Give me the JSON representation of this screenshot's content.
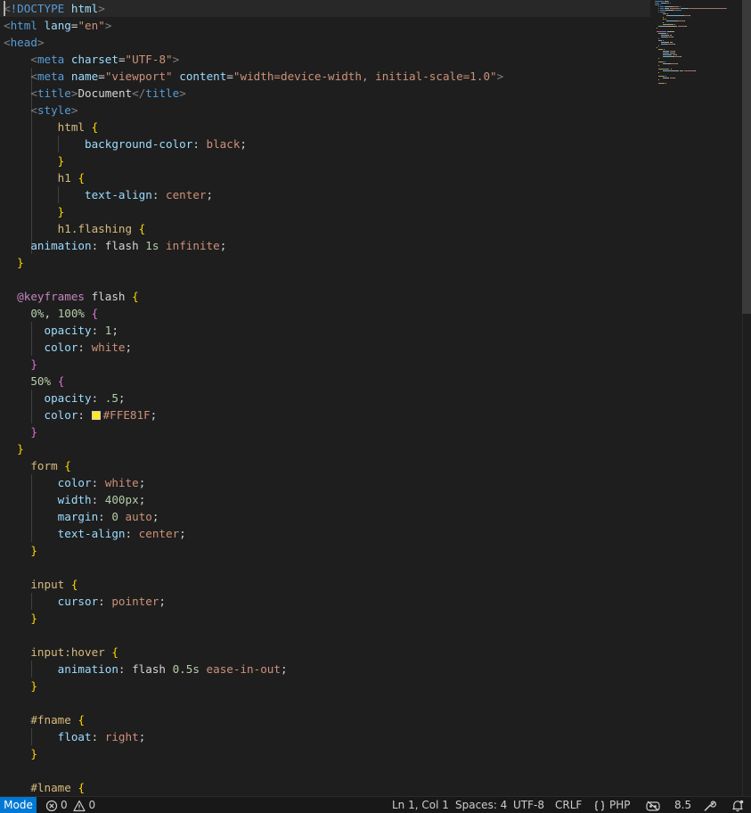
{
  "editor": {
    "lines": [
      [
        [
          "t-punc",
          "<"
        ],
        [
          "t-doctype",
          "!DOCTYPE"
        ],
        [
          "t-text",
          " "
        ],
        [
          "t-attr",
          "html"
        ],
        [
          "t-punc",
          ">"
        ]
      ],
      [
        [
          "t-punc",
          "<"
        ],
        [
          "t-tag",
          "html"
        ],
        [
          "t-text",
          " "
        ],
        [
          "t-attr",
          "lang"
        ],
        [
          "t-text",
          "="
        ],
        [
          "t-str",
          "\"en\""
        ],
        [
          "t-punc",
          ">"
        ]
      ],
      [
        [
          "t-punc",
          "<"
        ],
        [
          "t-tag",
          "head"
        ],
        [
          "t-punc",
          ">"
        ]
      ],
      [
        [
          "t-text",
          "    "
        ],
        [
          "t-punc",
          "<"
        ],
        [
          "t-tag",
          "meta"
        ],
        [
          "t-text",
          " "
        ],
        [
          "t-attr",
          "charset"
        ],
        [
          "t-text",
          "="
        ],
        [
          "t-str",
          "\"UTF-8\""
        ],
        [
          "t-punc",
          ">"
        ]
      ],
      [
        [
          "t-text",
          "    "
        ],
        [
          "t-punc",
          "<"
        ],
        [
          "t-tag",
          "meta"
        ],
        [
          "t-text",
          " "
        ],
        [
          "t-attr",
          "name"
        ],
        [
          "t-text",
          "="
        ],
        [
          "t-str",
          "\"viewport\""
        ],
        [
          "t-text",
          " "
        ],
        [
          "t-attr",
          "content"
        ],
        [
          "t-text",
          "="
        ],
        [
          "t-str",
          "\"width=device-width, initial-scale=1.0\""
        ],
        [
          "t-punc",
          ">"
        ]
      ],
      [
        [
          "t-text",
          "    "
        ],
        [
          "t-punc",
          "<"
        ],
        [
          "t-tag",
          "title"
        ],
        [
          "t-punc",
          ">"
        ],
        [
          "t-text",
          "Document"
        ],
        [
          "t-punc",
          "</"
        ],
        [
          "t-tag",
          "title"
        ],
        [
          "t-punc",
          ">"
        ]
      ],
      [
        [
          "t-text",
          "    "
        ],
        [
          "t-punc",
          "<"
        ],
        [
          "t-tag",
          "style"
        ],
        [
          "t-punc",
          ">"
        ]
      ],
      [
        [
          "t-text",
          "        "
        ],
        [
          "t-sel",
          "html"
        ],
        [
          "t-text",
          " "
        ],
        [
          "t-b1",
          "{"
        ]
      ],
      [
        [
          "t-text",
          "            "
        ],
        [
          "t-prop",
          "background-color"
        ],
        [
          "t-text",
          ": "
        ],
        [
          "t-val",
          "black"
        ],
        [
          "t-text",
          ";"
        ]
      ],
      [
        [
          "t-text",
          "        "
        ],
        [
          "t-b1",
          "}"
        ]
      ],
      [
        [
          "t-text",
          "        "
        ],
        [
          "t-sel",
          "h1"
        ],
        [
          "t-text",
          " "
        ],
        [
          "t-b1",
          "{"
        ]
      ],
      [
        [
          "t-text",
          "            "
        ],
        [
          "t-prop",
          "text-align"
        ],
        [
          "t-text",
          ": "
        ],
        [
          "t-val",
          "center"
        ],
        [
          "t-text",
          ";"
        ]
      ],
      [
        [
          "t-text",
          "        "
        ],
        [
          "t-b1",
          "}"
        ]
      ],
      [
        [
          "t-text",
          "        "
        ],
        [
          "t-sel",
          "h1.flashing"
        ],
        [
          "t-text",
          " "
        ],
        [
          "t-b1",
          "{"
        ]
      ],
      [
        [
          "t-text",
          "    "
        ],
        [
          "t-prop",
          "animation"
        ],
        [
          "t-text",
          ": flash "
        ],
        [
          "t-num",
          "1s"
        ],
        [
          "t-text",
          " "
        ],
        [
          "t-val",
          "infinite"
        ],
        [
          "t-text",
          ";"
        ]
      ],
      [
        [
          "t-text",
          "  "
        ],
        [
          "t-b1",
          "}"
        ]
      ],
      [],
      [
        [
          "t-text",
          "  "
        ],
        [
          "t-at",
          "@keyframes"
        ],
        [
          "t-text",
          " flash "
        ],
        [
          "t-b1",
          "{"
        ]
      ],
      [
        [
          "t-text",
          "    "
        ],
        [
          "t-num",
          "0%"
        ],
        [
          "t-text",
          ", "
        ],
        [
          "t-num",
          "100%"
        ],
        [
          "t-text",
          " "
        ],
        [
          "t-b2",
          "{"
        ]
      ],
      [
        [
          "t-text",
          "      "
        ],
        [
          "t-prop",
          "opacity"
        ],
        [
          "t-text",
          ": "
        ],
        [
          "t-num",
          "1"
        ],
        [
          "t-text",
          ";"
        ]
      ],
      [
        [
          "t-text",
          "      "
        ],
        [
          "t-prop",
          "color"
        ],
        [
          "t-text",
          ": "
        ],
        [
          "t-val",
          "white"
        ],
        [
          "t-text",
          ";"
        ]
      ],
      [
        [
          "t-text",
          "    "
        ],
        [
          "t-b2",
          "}"
        ]
      ],
      [
        [
          "t-text",
          "    "
        ],
        [
          "t-num",
          "50%"
        ],
        [
          "t-text",
          " "
        ],
        [
          "t-b2",
          "{"
        ]
      ],
      [
        [
          "t-text",
          "      "
        ],
        [
          "t-prop",
          "opacity"
        ],
        [
          "t-text",
          ": "
        ],
        [
          "t-num",
          ".5"
        ],
        [
          "t-text",
          ";"
        ]
      ],
      [
        [
          "t-text",
          "      "
        ],
        [
          "t-prop",
          "color"
        ],
        [
          "t-text",
          ": "
        ],
        [
          "swatch",
          "#FFE81F"
        ],
        [
          "t-val",
          "#FFE81F"
        ],
        [
          "t-text",
          ";"
        ]
      ],
      [
        [
          "t-text",
          "    "
        ],
        [
          "t-b2",
          "}"
        ]
      ],
      [
        [
          "t-text",
          "  "
        ],
        [
          "t-b1",
          "}"
        ]
      ],
      [
        [
          "t-text",
          "    "
        ],
        [
          "t-sel",
          "form"
        ],
        [
          "t-text",
          " "
        ],
        [
          "t-b1",
          "{"
        ]
      ],
      [
        [
          "t-text",
          "        "
        ],
        [
          "t-prop",
          "color"
        ],
        [
          "t-text",
          ": "
        ],
        [
          "t-val",
          "white"
        ],
        [
          "t-text",
          ";"
        ]
      ],
      [
        [
          "t-text",
          "        "
        ],
        [
          "t-prop",
          "width"
        ],
        [
          "t-text",
          ": "
        ],
        [
          "t-num",
          "400px"
        ],
        [
          "t-text",
          ";"
        ]
      ],
      [
        [
          "t-text",
          "        "
        ],
        [
          "t-prop",
          "margin"
        ],
        [
          "t-text",
          ": "
        ],
        [
          "t-num",
          "0"
        ],
        [
          "t-text",
          " "
        ],
        [
          "t-val",
          "auto"
        ],
        [
          "t-text",
          ";"
        ]
      ],
      [
        [
          "t-text",
          "        "
        ],
        [
          "t-prop",
          "text-align"
        ],
        [
          "t-text",
          ": "
        ],
        [
          "t-val",
          "center"
        ],
        [
          "t-text",
          ";"
        ]
      ],
      [
        [
          "t-text",
          "    "
        ],
        [
          "t-b1",
          "}"
        ]
      ],
      [],
      [
        [
          "t-text",
          "    "
        ],
        [
          "t-sel",
          "input"
        ],
        [
          "t-text",
          " "
        ],
        [
          "t-b1",
          "{"
        ]
      ],
      [
        [
          "t-text",
          "        "
        ],
        [
          "t-prop",
          "cursor"
        ],
        [
          "t-text",
          ": "
        ],
        [
          "t-val",
          "pointer"
        ],
        [
          "t-text",
          ";"
        ]
      ],
      [
        [
          "t-text",
          "    "
        ],
        [
          "t-b1",
          "}"
        ]
      ],
      [],
      [
        [
          "t-text",
          "    "
        ],
        [
          "t-sel",
          "input:hover"
        ],
        [
          "t-text",
          " "
        ],
        [
          "t-b1",
          "{"
        ]
      ],
      [
        [
          "t-text",
          "        "
        ],
        [
          "t-prop",
          "animation"
        ],
        [
          "t-text",
          ": flash "
        ],
        [
          "t-num",
          "0.5s"
        ],
        [
          "t-text",
          " "
        ],
        [
          "t-val",
          "ease-in-out"
        ],
        [
          "t-text",
          ";"
        ]
      ],
      [
        [
          "t-text",
          "    "
        ],
        [
          "t-b1",
          "}"
        ]
      ],
      [],
      [
        [
          "t-text",
          "    "
        ],
        [
          "t-sel",
          "#fname"
        ],
        [
          "t-text",
          " "
        ],
        [
          "t-b1",
          "{"
        ]
      ],
      [
        [
          "t-text",
          "        "
        ],
        [
          "t-prop",
          "float"
        ],
        [
          "t-text",
          ": "
        ],
        [
          "t-val",
          "right"
        ],
        [
          "t-text",
          ";"
        ]
      ],
      [
        [
          "t-text",
          "    "
        ],
        [
          "t-b1",
          "}"
        ]
      ],
      [],
      [
        [
          "t-text",
          "    "
        ],
        [
          "t-sel",
          "#lname"
        ],
        [
          "t-text",
          " "
        ],
        [
          "t-b1",
          "{"
        ]
      ]
    ]
  },
  "statusbar": {
    "mode": "Mode",
    "errors": "0",
    "warnings": "0",
    "position": "Ln 1, Col 1",
    "spaces": "Spaces: 4",
    "encoding": "UTF-8",
    "eol": "CRLF",
    "language": "PHP",
    "version": "8.5",
    "icons": {
      "errors": "error-circle-icon",
      "warnings": "warning-triangle-icon",
      "language": "braces-icon",
      "copilot": "copilot-icon",
      "tools": "wrench-icon",
      "notifications": "bell-icon"
    }
  },
  "colors": {
    "editor_bg": "#1e1e1e",
    "status_bg": "#181818",
    "mode_bg": "#0078d4",
    "swatch": "#FFE81F"
  }
}
